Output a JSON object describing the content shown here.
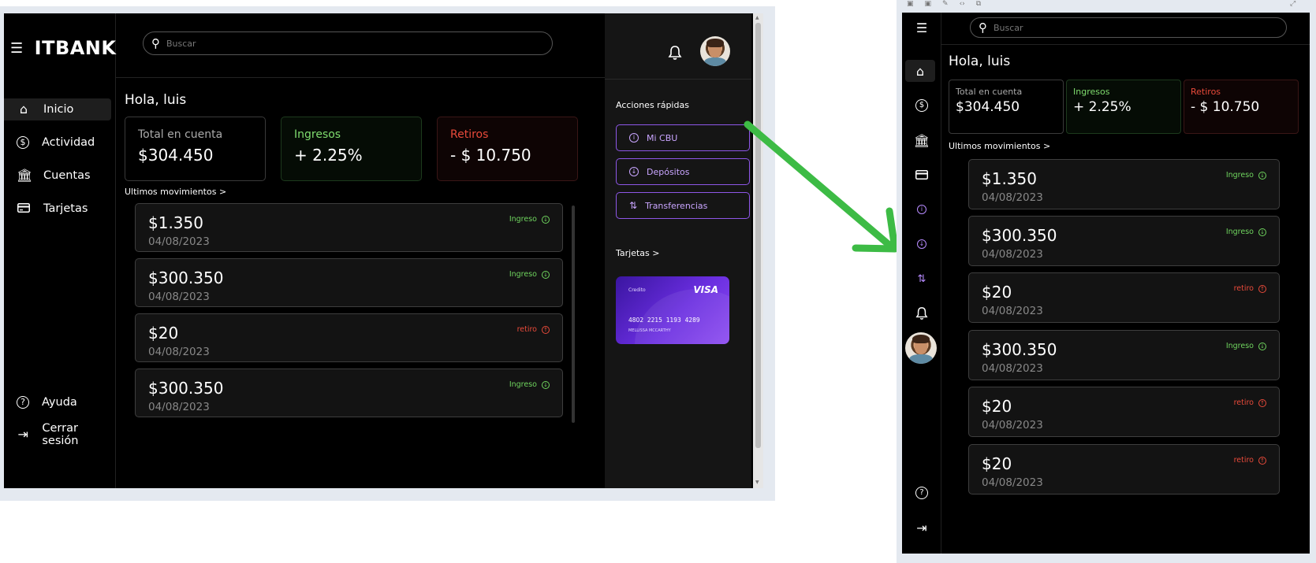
{
  "desktop": {
    "logo": "ITBANK",
    "search_placeholder": "Buscar",
    "nav": [
      {
        "label": "Inicio",
        "icon": "home-icon"
      },
      {
        "label": "Actividad",
        "icon": "dollar-circle-icon"
      },
      {
        "label": "Cuentas",
        "icon": "bank-icon"
      },
      {
        "label": "Tarjetas",
        "icon": "credit-card-icon"
      }
    ],
    "bottom_nav": [
      {
        "label": "Ayuda",
        "icon": "help-icon"
      },
      {
        "label": "Cerrar sesión",
        "icon": "logout-icon"
      }
    ],
    "greeting": "Hola, luis",
    "cards": [
      {
        "label": "Total en cuenta",
        "value": "$304.450"
      },
      {
        "label": "Ingresos",
        "value": "+ 2.25%"
      },
      {
        "label": "Retiros",
        "value": "- $ 10.750"
      }
    ],
    "movements_title": "Ultimos movimientos >",
    "movements": [
      {
        "amount": "$1.350",
        "date": "04/08/2023",
        "tag": "Ingreso",
        "kind": "in"
      },
      {
        "amount": "$300.350",
        "date": "04/08/2023",
        "tag": "Ingreso",
        "kind": "in"
      },
      {
        "amount": "$20",
        "date": "04/08/2023",
        "tag": "retiro",
        "kind": "out"
      },
      {
        "amount": "$300.350",
        "date": "04/08/2023",
        "tag": "Ingreso",
        "kind": "in"
      }
    ],
    "quick_actions_title": "Acciones rápidas",
    "quick_actions": [
      {
        "label": "Mi CBU",
        "icon": "info-icon"
      },
      {
        "label": "Depósitos",
        "icon": "download-icon"
      },
      {
        "label": "Transferencias",
        "icon": "transfer-icon"
      }
    ],
    "cards_title": "Tarjetas >",
    "credit_card": {
      "type": "Credito",
      "brand": "VISA",
      "number": "4802  2215  1193  4289",
      "holder": "MELLISSA MCCARTHY"
    }
  },
  "mobile": {
    "search_placeholder": "Buscar",
    "greeting": "Hola, luis",
    "cards": [
      {
        "label": "Total en cuenta",
        "value": "$304.450"
      },
      {
        "label": "Ingresos",
        "value": "+ 2.25%"
      },
      {
        "label": "Retiros",
        "value": "- $ 10.750"
      }
    ],
    "movements_title": "Ultimos movimientos >",
    "movements": [
      {
        "amount": "$1.350",
        "date": "04/08/2023",
        "tag": "Ingreso",
        "kind": "in"
      },
      {
        "amount": "$300.350",
        "date": "04/08/2023",
        "tag": "Ingreso",
        "kind": "in"
      },
      {
        "amount": "$20",
        "date": "04/08/2023",
        "tag": "retiro",
        "kind": "out"
      },
      {
        "amount": "$300.350",
        "date": "04/08/2023",
        "tag": "Ingreso",
        "kind": "in"
      },
      {
        "amount": "$20",
        "date": "04/08/2023",
        "tag": "retiro",
        "kind": "out"
      },
      {
        "amount": "$20",
        "date": "04/08/2023",
        "tag": "retiro",
        "kind": "out"
      }
    ]
  },
  "colors": {
    "accent_purple": "#8e57e8",
    "income_green": "#6fd45e",
    "withdrawal_red": "#e84a3a",
    "arrow_green": "#3dbb45"
  }
}
